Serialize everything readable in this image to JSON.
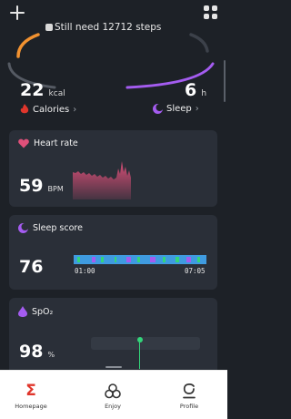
{
  "header": {
    "steps_remaining": "Still need 12712 steps"
  },
  "stats": {
    "calories": {
      "value": "22",
      "unit": "kcal",
      "label": "Calories"
    },
    "sleep": {
      "value": "6",
      "unit": "h",
      "label": "Sleep"
    }
  },
  "heart_rate": {
    "title": "Heart rate",
    "value": "59",
    "unit": "BPM"
  },
  "sleep_score": {
    "title": "Sleep score",
    "value": "76",
    "start_time": "01:00",
    "end_time": "07:05"
  },
  "spo2": {
    "title": "SpO₂",
    "value": "98",
    "unit": "%"
  },
  "tabs": [
    {
      "label": "Homepage",
      "active": true
    },
    {
      "label": "Enjoy",
      "active": false
    },
    {
      "label": "Profile",
      "active": false
    }
  ],
  "colors": {
    "accent_red": "#e0362c",
    "sleep_purple": "#a45cf0",
    "heart_pink": "#e0507a",
    "spo2_green": "#33d67a",
    "steps_orange": "#f29230"
  },
  "icons": {
    "add": "plus-icon",
    "widgets": "grid-icon",
    "calories": "flame-icon",
    "sleep": "moon-icon",
    "heart": "heart-icon",
    "spo2": "drop-icon",
    "homepage": "sigma-icon",
    "enjoy": "enjoy-icon",
    "profile": "profile-icon"
  }
}
